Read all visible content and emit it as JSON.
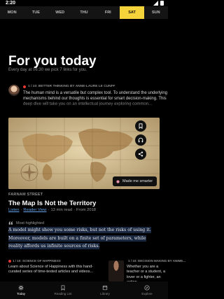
{
  "status": {
    "time": "2:20"
  },
  "days": [
    "MON",
    "TUE",
    "WED",
    "THU",
    "FRI",
    "SAT",
    "SUN"
  ],
  "active_day": "SAT",
  "header": {
    "title": "For you today",
    "subtitle": "Every day at 06:30 we pick 7 links for you."
  },
  "snippet": {
    "label": "1 / 10: BETTER THINKING BY ANNE-LAURE LE CUNFF",
    "text": "The human mind is a versatile but complex tool. To understand the underlying mechanisms behind our thoughts is essential for smart decision-making. This deep dive will take you on an intellectual journey exploring common..."
  },
  "article": {
    "made_me_smarter": "Made me smarter",
    "source": "FARNAM STREET",
    "title": "The Map Is Not the Territory",
    "meta": {
      "listen": "Listen",
      "sep1": "·",
      "reader_view": "Reader View",
      "sep2": "·",
      "read_time": "13 min read",
      "sep3": "·",
      "from": "From 2018"
    },
    "most_highlighted_label": "Most highlighted",
    "highlight": "A model might show you some risks, but not the risks of using it. Moreover, models are built on a finite set of parameters, while reality affords us infinite sources of risks."
  },
  "recommendations": [
    {
      "label": "1 / 10: SCIENCE OF HAPPINESS",
      "text": "Learn about Science of Happiness with this hand-curated series of time-tested articles and videos..."
    },
    {
      "label": "1 / 10: DECISION MAKING BY ANIME...",
      "text": "Whether you are a teacher or a student, a lover or a fighter, an action..."
    }
  ],
  "nav": [
    {
      "label": "Today",
      "icon": "sun-icon"
    },
    {
      "label": "Reading List",
      "icon": "bookmark-icon"
    },
    {
      "label": "Library",
      "icon": "library-icon"
    },
    {
      "label": "Explore",
      "icon": "explore-icon"
    }
  ],
  "colors": {
    "accent": "#f5d33b",
    "link": "#62a3e6",
    "badge": "#e53935"
  }
}
